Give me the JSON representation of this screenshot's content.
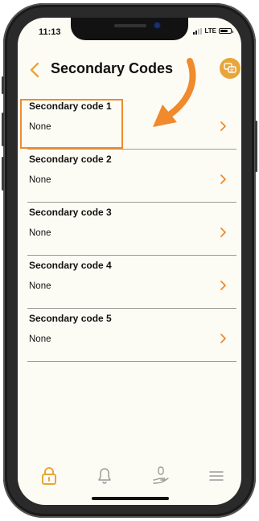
{
  "status_bar": {
    "time": "11:13",
    "network": "LTE"
  },
  "header": {
    "title": "Secondary Codes"
  },
  "items": [
    {
      "label": "Secondary code 1",
      "value": "None"
    },
    {
      "label": "Secondary code 2",
      "value": "None"
    },
    {
      "label": "Secondary code 3",
      "value": "None"
    },
    {
      "label": "Secondary code 4",
      "value": "None"
    },
    {
      "label": "Secondary code 5",
      "value": "None"
    }
  ],
  "tabbar": {
    "tabs": [
      "lock-icon",
      "bell-icon",
      "hand-icon",
      "menu-icon"
    ],
    "active": "lock-icon"
  },
  "colors": {
    "accent": "#f08a2c",
    "chat_button": "#e8a53a",
    "background": "#fdfcf4",
    "inactive_icon": "#9a9a9a"
  }
}
